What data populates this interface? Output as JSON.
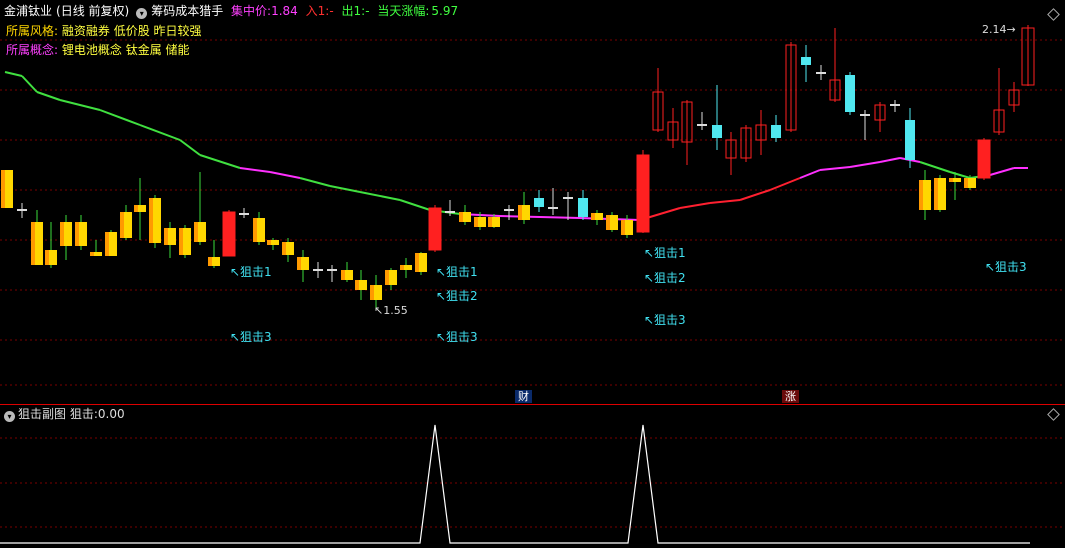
{
  "header": {
    "stock_name": "金浦钛业",
    "period": "(日线 前复权)",
    "indicator_name": "筹码成本猎手",
    "concentration_label": "集中价:",
    "concentration_value": "1.84",
    "in_label": "入1:",
    "in_value": "-",
    "out_label": "出1:",
    "out_value": "-",
    "change_label": "当天涨幅:",
    "change_value": "5.97"
  },
  "style_row": {
    "label": "所属风格:",
    "value": "融资融券 低价股 昨日较强"
  },
  "concept_row": {
    "label": "所属概念:",
    "value": "锂电池概念 钛金属 储能"
  },
  "annotations": {
    "high_price": "2.14",
    "low_price": "1.55",
    "signal_texts": [
      "狙击1",
      "狙击3",
      "狙击1",
      "狙击2",
      "狙击3",
      "狙击1",
      "狙击2",
      "狙击3",
      "狙击3"
    ]
  },
  "axis_marks": {
    "finance": "财",
    "limit": "涨"
  },
  "sub_panel": {
    "title": "狙击副图",
    "value_label": "狙击:",
    "value": "0.00"
  },
  "colors": {
    "up": "#ff2020",
    "down_cyan": "#50e8f0",
    "yellow": "#ffd700",
    "ma_green": "#40e040",
    "ma_magenta": "#ff30ff",
    "ma_red": "#ff2030",
    "grid": "#7a0000",
    "signal_text": "#40e0f0"
  },
  "chart_data": {
    "type": "candlestick",
    "price_labels": {
      "high": 2.14,
      "low": 1.55
    },
    "sub_series": {
      "name": "狙击",
      "current": 0.0,
      "peaks": 2
    }
  }
}
